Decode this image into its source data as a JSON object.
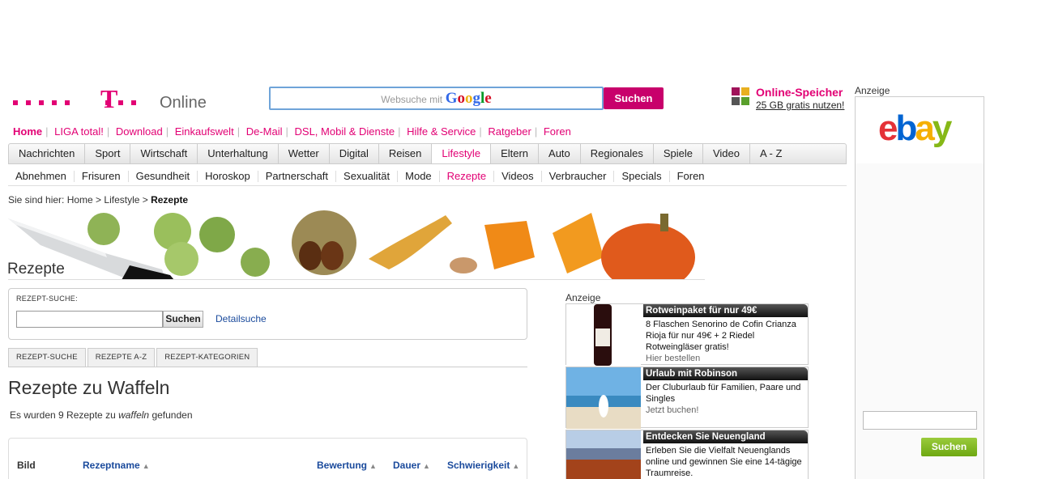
{
  "header": {
    "logo_t": "T",
    "logo_text": "Online",
    "search_placeholder": "Websuche mit",
    "search_brand": "Google",
    "search_button": "Suchen",
    "speicher_title": "Online-Speicher",
    "speicher_sub": "25 GB gratis nutzen!"
  },
  "top_links": [
    "Home",
    "LIGA total!",
    "Download",
    "Einkaufswelt",
    "De-Mail",
    "DSL, Mobil & Dienste",
    "Hilfe & Service",
    "Ratgeber",
    "Foren"
  ],
  "main_nav": [
    "Nachrichten",
    "Sport",
    "Wirtschaft",
    "Unterhaltung",
    "Wetter",
    "Digital",
    "Reisen",
    "Lifestyle",
    "Eltern",
    "Auto",
    "Regionales",
    "Spiele",
    "Video",
    "A - Z"
  ],
  "sub_nav": [
    "Abnehmen",
    "Frisuren",
    "Gesundheit",
    "Horoskop",
    "Partnerschaft",
    "Sexualität",
    "Mode",
    "Rezepte",
    "Videos",
    "Verbraucher",
    "Specials",
    "Foren"
  ],
  "breadcrumb": {
    "prefix": "Sie sind hier: Home > Lifestyle > ",
    "current": "Rezepte"
  },
  "banner_title": "Rezepte",
  "recipe_search": {
    "label": "REZEPT-SUCHE:",
    "button": "Suchen",
    "detail": "Detailsuche"
  },
  "tabs": [
    "REZEPT-SUCHE",
    "REZEPTE A-Z",
    "REZEPT-KATEGORIEN"
  ],
  "heading": "Rezepte zu Waffeln",
  "found": {
    "pre": "Es wurden 9 Rezepte zu ",
    "term": "waffeln",
    "post": " gefunden"
  },
  "table_headers": {
    "bild": "Bild",
    "name": "Rezeptname",
    "rating": "Bewertung",
    "dauer": "Dauer",
    "level": "Schwierigkeit"
  },
  "anzeige": "Anzeige",
  "ads": [
    {
      "title": "Rotweinpaket für nur 49€",
      "body": "8 Flaschen Senorino de Cofin Crianza Rioja für nur 49€ + 2 Riedel Rotweingläser gratis!",
      "cta": "Hier bestellen"
    },
    {
      "title": "Urlaub mit Robinson",
      "body": "Der Cluburlaub für Familien, Paare und Singles",
      "cta": "Jetzt buchen!"
    },
    {
      "title": "Entdecken Sie Neuengland",
      "body": "Erleben Sie die Vielfalt Neuenglands online und gewinnen Sie eine 14-tägige Traumreise.",
      "cta": ""
    }
  ],
  "ebay": {
    "anzeige": "Anzeige",
    "logo": [
      "e",
      "b",
      "a",
      "y"
    ],
    "button": "Suchen"
  },
  "colors": {
    "brand": "#e20074",
    "link": "#1a4a9c"
  }
}
